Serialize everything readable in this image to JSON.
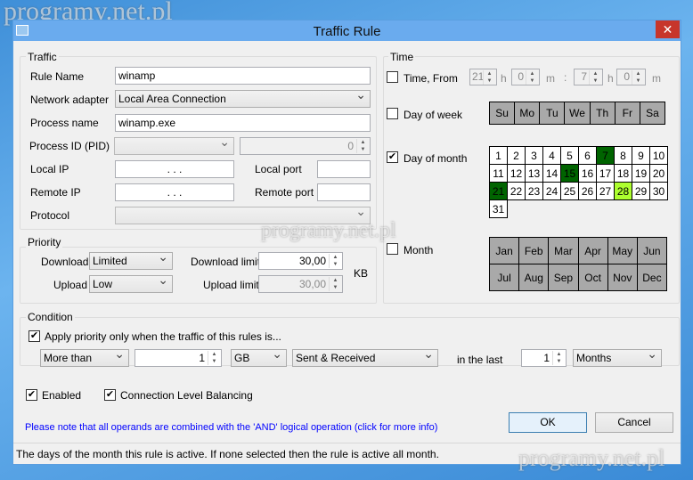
{
  "watermark": "programy.net.pl",
  "window": {
    "title": "Traffic Rule",
    "close": "✕"
  },
  "traffic": {
    "label": "Traffic",
    "rule_name_label": "Rule Name",
    "rule_name": "winamp",
    "adapter_label": "Network adapter",
    "adapter": "Local Area Connection",
    "process_name_label": "Process name",
    "process_name": "winamp.exe",
    "pid_label": "Process ID (PID)",
    "pid_select": "",
    "pid_value": "0",
    "local_ip_label": "Local IP",
    "ip_placeholder": ".          .          .",
    "local_port_label": "Local port",
    "remote_ip_label": "Remote IP",
    "remote_port_label": "Remote port",
    "protocol_label": "Protocol",
    "protocol": ""
  },
  "priority": {
    "label": "Priority",
    "download_label": "Download",
    "download": "Limited",
    "upload_label": "Upload",
    "upload": "Low",
    "download_limit_label": "Download limit",
    "download_limit": "30,00",
    "upload_limit_label": "Upload limit",
    "upload_limit": "30,00",
    "unit": "KB"
  },
  "time": {
    "label": "Time",
    "time_from_label": "Time, From",
    "time_from_checked": false,
    "from_h": "21",
    "from_m": "0",
    "to_h": "7",
    "to_m": "0",
    "h": "h",
    "m": "m",
    "colon": ":",
    "dow_label": "Day of week",
    "dow_checked": false,
    "days_of_week": [
      "Su",
      "Mo",
      "Tu",
      "We",
      "Th",
      "Fr",
      "Sa"
    ],
    "dom_label": "Day of month",
    "dom_checked": true,
    "days_selected": [
      7,
      15,
      21
    ],
    "day_highlight": 28,
    "month_label": "Month",
    "month_checked": false,
    "months": [
      "Jan",
      "Feb",
      "Mar",
      "Apr",
      "May",
      "Jun",
      "Jul",
      "Aug",
      "Sep",
      "Oct",
      "Nov",
      "Dec"
    ]
  },
  "condition": {
    "label": "Condition",
    "apply_label": "Apply priority only when the traffic of this rules is...",
    "apply_checked": true,
    "comparator": "More than",
    "amount": "1",
    "unit": "GB",
    "direction": "Sent & Received",
    "in_the_last": "in the last",
    "period_count": "1",
    "period": "Months"
  },
  "options": {
    "enabled": "Enabled",
    "clb": "Connection Level Balancing"
  },
  "note": "Please note that all operands are combined with the 'AND' logical operation (click for more info)",
  "buttons": {
    "ok": "OK",
    "cancel": "Cancel"
  },
  "status": "The days of the month this rule is active. If none selected then the rule is active all month.",
  "colors": {
    "selected_day": "#006400",
    "highlight_day": "#adff2f",
    "disabled_cell": "#a9a9a9",
    "link": "#0000ff"
  }
}
